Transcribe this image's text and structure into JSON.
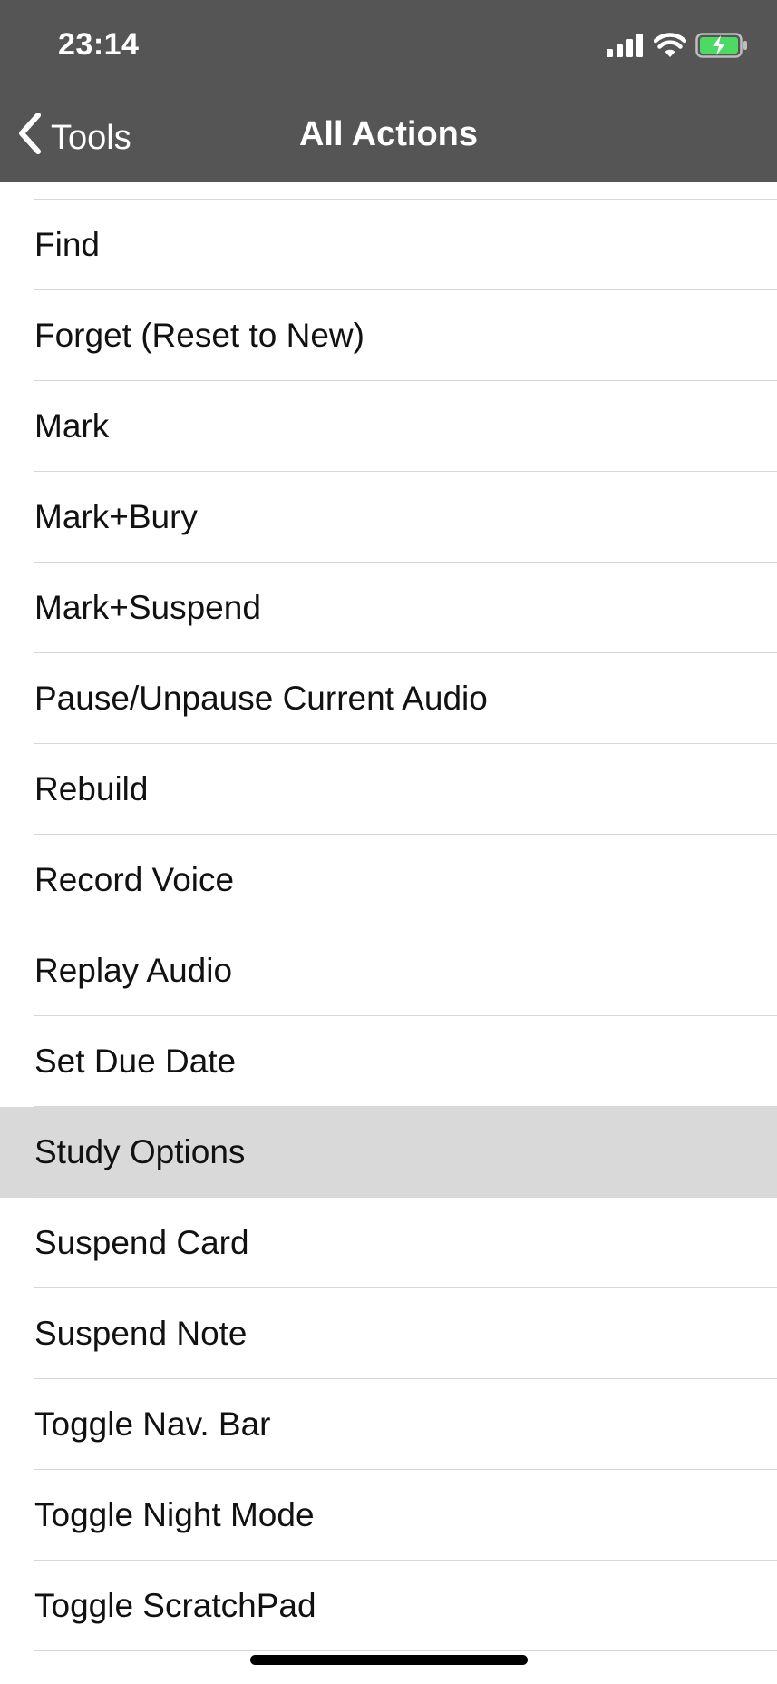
{
  "status_bar": {
    "time": "23:14",
    "icons": [
      "cellular-signal-icon",
      "wifi-icon",
      "battery-charging-icon"
    ],
    "battery_color": "#4cd964"
  },
  "nav": {
    "back_label": "Tools",
    "title": "All Actions",
    "background": "#555555"
  },
  "actions": [
    {
      "label": "Find",
      "selected": false
    },
    {
      "label": "Forget (Reset to New)",
      "selected": false
    },
    {
      "label": "Mark",
      "selected": false
    },
    {
      "label": "Mark+Bury",
      "selected": false
    },
    {
      "label": "Mark+Suspend",
      "selected": false
    },
    {
      "label": "Pause/Unpause Current Audio",
      "selected": false
    },
    {
      "label": "Rebuild",
      "selected": false
    },
    {
      "label": "Record Voice",
      "selected": false
    },
    {
      "label": "Replay Audio",
      "selected": false
    },
    {
      "label": "Set Due Date",
      "selected": false
    },
    {
      "label": "Study Options",
      "selected": true
    },
    {
      "label": "Suspend Card",
      "selected": false
    },
    {
      "label": "Suspend Note",
      "selected": false
    },
    {
      "label": "Toggle Nav. Bar",
      "selected": false
    },
    {
      "label": "Toggle Night Mode",
      "selected": false
    },
    {
      "label": "Toggle ScratchPad",
      "selected": false
    }
  ]
}
